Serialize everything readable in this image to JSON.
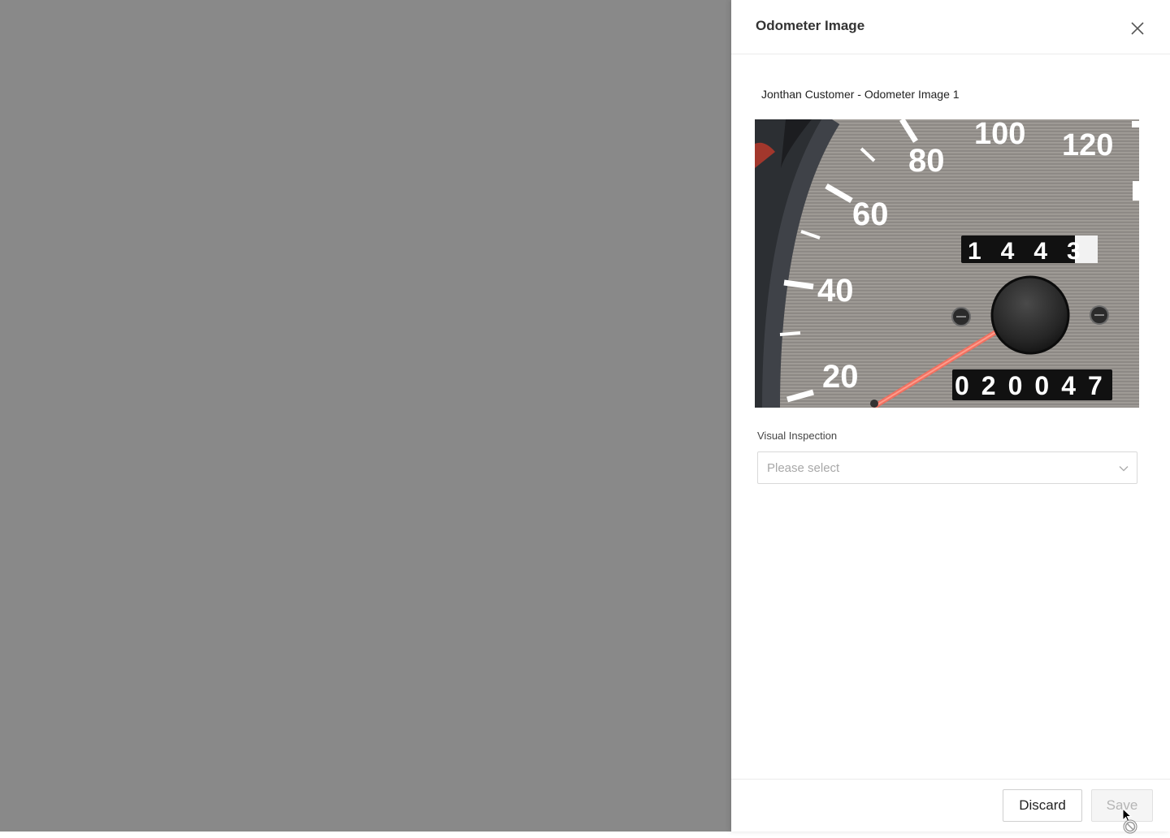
{
  "drawer": {
    "title": "Odometer Image",
    "close_icon": "close-icon"
  },
  "image": {
    "caption": "Jonthan Customer - Odometer Image 1",
    "speedometer_ticks": [
      "20",
      "40",
      "60",
      "80",
      "100",
      "120"
    ],
    "trip_reading": "1443",
    "odometer_reading": "020047"
  },
  "visual_inspection": {
    "label": "Visual Inspection",
    "placeholder": "Please select",
    "chevron_icon": "chevron-down-icon"
  },
  "footer": {
    "discard_label": "Discard",
    "save_label": "Save"
  },
  "colors": {
    "overlay": "#898989",
    "needle": "#f07060",
    "save_disabled_text": "#b5b5b5"
  }
}
